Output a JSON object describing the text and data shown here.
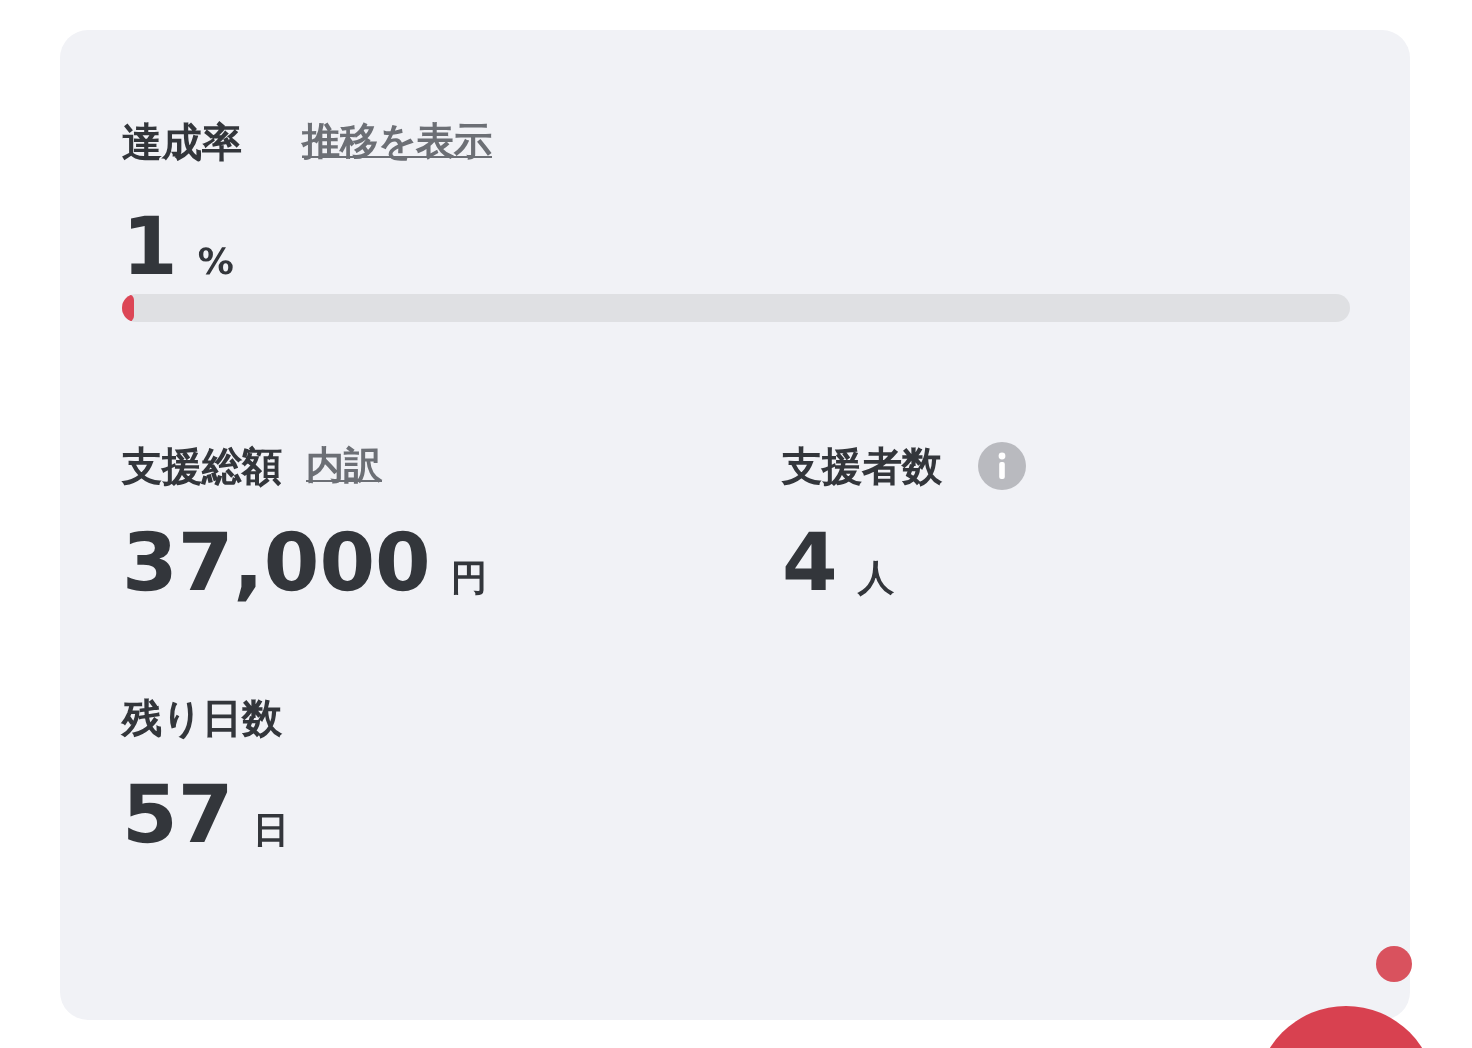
{
  "achievement": {
    "label": "達成率",
    "link": "推移を表示",
    "value": "1",
    "unit": "%",
    "level": 0.01
  },
  "stats": [
    {
      "label": "支援総額",
      "link": "内訳",
      "info": false,
      "value": "37,000",
      "unit": "円"
    },
    {
      "label": "支援者数",
      "info": true,
      "value": "4",
      "unit": "人"
    },
    {
      "label": "残り日数",
      "info": false,
      "value": "57",
      "unit": "日"
    }
  ]
}
